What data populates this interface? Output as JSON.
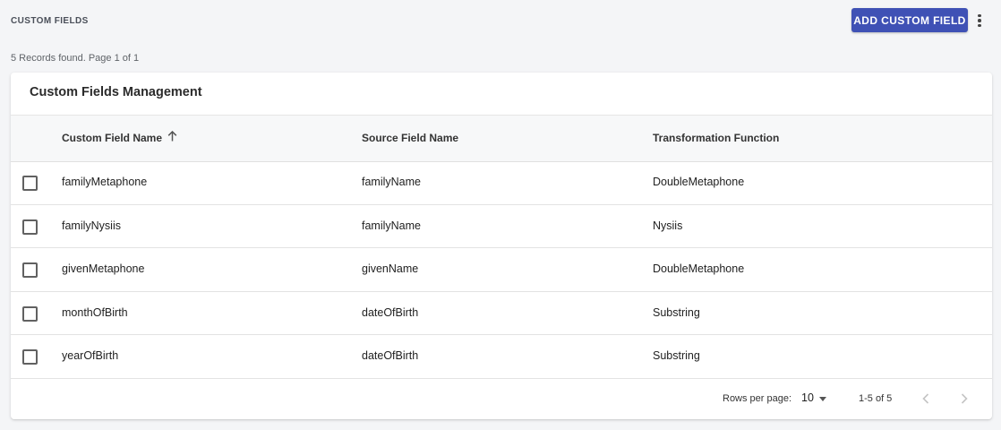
{
  "header": {
    "page_title": "CUSTOM FIELDS",
    "add_button_label": "ADD CUSTOM FIELD",
    "more_icon": "more-vert-icon",
    "accent_color": "#3f51b5"
  },
  "records_info": "5 Records found. Page 1 of 1",
  "card": {
    "title": "Custom Fields Management"
  },
  "table": {
    "columns": [
      "Custom Field Name",
      "Source Field Name",
      "Transformation Function"
    ],
    "sort": {
      "column": "Custom Field Name",
      "direction": "ascending",
      "icon": "arrow-up-icon"
    },
    "rows": [
      {
        "name": "familyMetaphone",
        "source": "familyName",
        "function": "DoubleMetaphone"
      },
      {
        "name": "familyNysiis",
        "source": "familyName",
        "function": "Nysiis"
      },
      {
        "name": "givenMetaphone",
        "source": "givenName",
        "function": "DoubleMetaphone"
      },
      {
        "name": "monthOfBirth",
        "source": "dateOfBirth",
        "function": "Substring"
      },
      {
        "name": "yearOfBirth",
        "source": "dateOfBirth",
        "function": "Substring"
      }
    ]
  },
  "pagination": {
    "rows_per_page_label": "Rows per page:",
    "rows_per_page_value": "10",
    "range_text": "1-5 of 5",
    "prev_icon": "chevron-left-icon",
    "next_icon": "chevron-right-icon"
  }
}
